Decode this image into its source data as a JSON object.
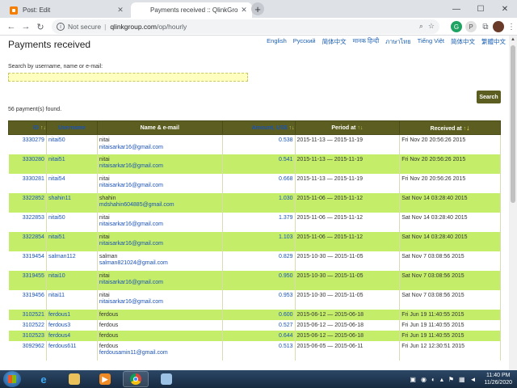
{
  "browser": {
    "tabs": [
      {
        "title": "Post: Edit"
      },
      {
        "title": "Payments received :: QlinkGroup"
      }
    ],
    "address": {
      "security": "Not secure",
      "domain": "qlinkgroup.com",
      "path": "/op/hourly"
    },
    "extensions": [
      "G",
      "P"
    ]
  },
  "page": {
    "title": "Payments received",
    "languages": [
      "English",
      "Русский",
      "简体中文",
      "मानक हिन्दी",
      "ภาษาไทย",
      "Tiếng Việt",
      "简体中文",
      "繁體中文"
    ],
    "search": {
      "label": "Search by username, name or e-mail:",
      "value": "",
      "button": "Search"
    },
    "found_text": "56 payment(s) found.",
    "table": {
      "columns": [
        {
          "label": "ID"
        },
        {
          "label": "Username"
        },
        {
          "label": "Name & e-mail"
        },
        {
          "label": "Amount, US$"
        },
        {
          "label": "Period at"
        },
        {
          "label": "Received at"
        }
      ],
      "rows": [
        {
          "id": "3330279",
          "username": "nitai50",
          "name": "nitai",
          "email": "nitaisarkar16@gmail.com",
          "amount": "0.538",
          "period": "2015-11-13 — 2015-11-19",
          "received": "Fri Nov 20 20:56:26 2015"
        },
        {
          "id": "3330280",
          "username": "nitai51",
          "name": "nitai",
          "email": "nitaisarkar16@gmail.com",
          "amount": "0.541",
          "period": "2015-11-13 — 2015-11-19",
          "received": "Fri Nov 20 20:56:26 2015"
        },
        {
          "id": "3330281",
          "username": "nitai54",
          "name": "nitai",
          "email": "nitaisarkar16@gmail.com",
          "amount": "0.668",
          "period": "2015-11-13 — 2015-11-19",
          "received": "Fri Nov 20 20:56:26 2015"
        },
        {
          "id": "3322852",
          "username": "shahin11",
          "name": "shahin",
          "email": "mdshahin604885@gmail.com",
          "amount": "1.030",
          "period": "2015-11-06 — 2015-11-12",
          "received": "Sat Nov 14 03:28:40 2015"
        },
        {
          "id": "3322853",
          "username": "nitai50",
          "name": "nitai",
          "email": "nitaisarkar16@gmail.com",
          "amount": "1.379",
          "period": "2015-11-06 — 2015-11-12",
          "received": "Sat Nov 14 03:28:40 2015"
        },
        {
          "id": "3322854",
          "username": "nitai51",
          "name": "nitai",
          "email": "nitaisarkar16@gmail.com",
          "amount": "1.103",
          "period": "2015-11-06 — 2015-11-12",
          "received": "Sat Nov 14 03:28:40 2015"
        },
        {
          "id": "3319454",
          "username": "salman112",
          "name": "salman",
          "email": "salman821024@gmail.com",
          "amount": "0.829",
          "period": "2015-10-30 — 2015-11-05",
          "received": "Sat Nov 7 03:08:56 2015"
        },
        {
          "id": "3319455",
          "username": "nitai10",
          "name": "nitai",
          "email": "nitaisarkar16@gmail.com",
          "amount": "0.950",
          "period": "2015-10-30 — 2015-11-05",
          "received": "Sat Nov 7 03:08:56 2015"
        },
        {
          "id": "3319456",
          "username": "nitai11",
          "name": "nitai",
          "email": "nitaisarkar16@gmail.com",
          "amount": "0.953",
          "period": "2015-10-30 — 2015-11-05",
          "received": "Sat Nov 7 03:08:56 2015"
        },
        {
          "id": "3102521",
          "username": "ferdous1",
          "name": "ferdous",
          "email": "",
          "amount": "0.600",
          "period": "2015-06-12 — 2015-06-18",
          "received": "Fri Jun 19 11:40:55 2015"
        },
        {
          "id": "3102522",
          "username": "ferdous3",
          "name": "ferdous",
          "email": "",
          "amount": "0.527",
          "period": "2015-06-12 — 2015-06-18",
          "received": "Fri Jun 19 11:40:55 2015"
        },
        {
          "id": "3102523",
          "username": "ferdous4",
          "name": "ferdous",
          "email": "",
          "amount": "0.644",
          "period": "2015-06-12 — 2015-06-18",
          "received": "Fri Jun 19 11:40:55 2015"
        },
        {
          "id": "3092962",
          "username": "ferdous611",
          "name": "ferdous",
          "email": "ferdousamin11@gmail.com",
          "amount": "0.513",
          "period": "2015-06-05 — 2015-06-11",
          "received": "Fri Jun 12 12:30:51 2015"
        }
      ]
    }
  },
  "taskbar": {
    "clock": {
      "time": "11:40 PM",
      "date": "11/26/2020"
    }
  }
}
